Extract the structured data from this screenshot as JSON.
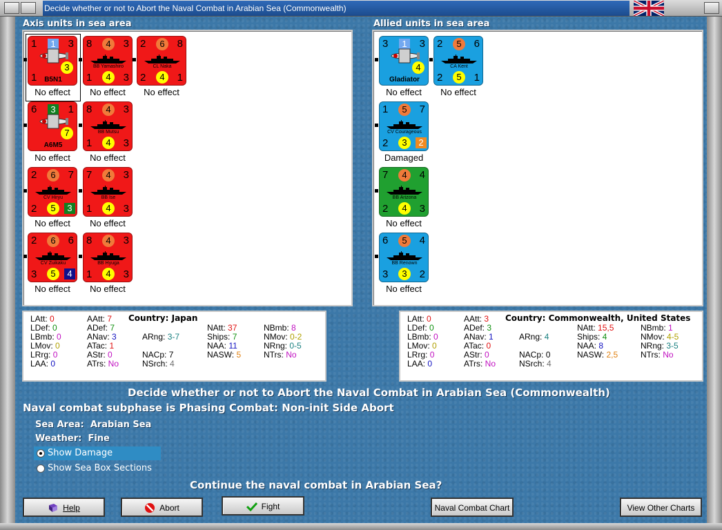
{
  "window": {
    "title": "Decide whether or not to Abort the Naval Combat in Arabian Sea (Commonwealth)"
  },
  "axis": {
    "title": "Axis units in sea area",
    "units": [
      {
        "kind": "plane",
        "name": "B5N1",
        "tl": "1",
        "blue": "1",
        "tr": "3",
        "bl": "1",
        "yellow": "3",
        "status": "No effect",
        "color": "red"
      },
      {
        "kind": "ship",
        "name": "BB Yamashiro",
        "tl": "8",
        "orange": "4",
        "tr": "3",
        "bl": "1",
        "yellow": "4",
        "br": "3",
        "status": "No effect",
        "color": "red"
      },
      {
        "kind": "ship",
        "name": "CL Naka",
        "tl": "2",
        "orange": "6",
        "tr": "8",
        "bl": "2",
        "yellow": "4",
        "br": "1",
        "status": "No effect",
        "color": "red"
      },
      {
        "kind": "plane",
        "name": "A6M5",
        "tl": "6",
        "green": "3",
        "tr": "1",
        "yellow": "7",
        "status": "No effect",
        "color": "red"
      },
      {
        "kind": "ship",
        "name": "BB Mutsu",
        "tl": "8",
        "orange": "4",
        "tr": "3",
        "bl": "1",
        "yellow": "4",
        "br": "3",
        "status": "No effect",
        "color": "red"
      },
      {
        "kind": "ship",
        "name": "CV Hiryu",
        "tl": "2",
        "orange": "6",
        "tr": "7",
        "bl": "2",
        "yellow": "5",
        "sq": "3",
        "status": "No effect",
        "color": "red"
      },
      {
        "kind": "ship",
        "name": "BB Ise",
        "tl": "7",
        "orange": "4",
        "tr": "3",
        "bl": "1",
        "yellow": "4",
        "br": "3",
        "status": "No effect",
        "color": "red"
      },
      {
        "kind": "ship",
        "name": "CV Zuikaku",
        "tl": "2",
        "orange": "6",
        "tr": "6",
        "bl": "3",
        "yellow": "5",
        "sq": "4",
        "status": "No effect",
        "color": "red"
      },
      {
        "kind": "ship",
        "name": "BB Hyuga",
        "tl": "8",
        "orange": "4",
        "tr": "3",
        "bl": "1",
        "yellow": "4",
        "br": "3",
        "status": "No effect",
        "color": "red"
      }
    ],
    "stats": {
      "country_label": "Country:",
      "country": "Japan",
      "LAtt": "0",
      "LDef": "0",
      "LBmb": "0",
      "LMov": "0",
      "LRrg": "0",
      "LAA": "0",
      "AAtt": "7",
      "ADef": "7",
      "ANav": "3",
      "ATac": "1",
      "AStr": "0",
      "ATrs": "No",
      "ARng": "3-7",
      "NACp": "7",
      "NSrch": "4",
      "NAtt": "37",
      "Ships": "7",
      "NAA": "11",
      "NASW": "5",
      "NBmb": "8",
      "NMov": "0-2",
      "NRng": "0-5",
      "NTrs": "No"
    }
  },
  "allied": {
    "title": "Allied units in sea area",
    "units": [
      {
        "kind": "plane",
        "name": "Gladiator",
        "tl": "3",
        "blue": "1",
        "tr": "3",
        "yellow": "4",
        "status": "No effect",
        "color": "blue"
      },
      {
        "kind": "ship",
        "name": "CA Kent",
        "tl": "2",
        "orange": "5",
        "tr": "6",
        "bl": "2",
        "yellow": "5",
        "br": "1",
        "status": "No effect",
        "color": "blue"
      },
      {
        "kind": "ship",
        "name": "CV Courageous",
        "tl": "1",
        "orange": "5",
        "tr": "7",
        "bl": "2",
        "yellow": "3",
        "sq": "2",
        "status": "Damaged",
        "color": "blue"
      },
      {
        "kind": "ship",
        "name": "BB Arizona",
        "tl": "7",
        "orange": "4",
        "tr": "4",
        "bl": "2",
        "yellow": "4",
        "br": "3",
        "status": "No effect",
        "color": "green"
      },
      {
        "kind": "ship",
        "name": "BB Renown",
        "tl": "6",
        "orange": "5",
        "tr": "4",
        "bl": "3",
        "yellow": "3",
        "br": "2",
        "status": "No effect",
        "color": "blue"
      }
    ],
    "stats": {
      "country_label": "Country:",
      "country": "Commonwealth, United States",
      "LAtt": "0",
      "LDef": "0",
      "LBmb": "0",
      "LMov": "0",
      "LRrg": "0",
      "LAA": "0",
      "AAtt": "3",
      "ADef": "3",
      "ANav": "1",
      "ATac": "0",
      "AStr": "0",
      "ATrs": "No",
      "ARng": "4",
      "NACp": "0",
      "NSrch": "4",
      "NAtt": "15,5",
      "Ships": "4",
      "NAA": "8",
      "NASW": "2,5",
      "NBmb": "1",
      "NMov": "4-5",
      "NRng": "3-5",
      "NTrs": "No"
    }
  },
  "main_heading": "Decide whether or not to Abort the Naval Combat in Arabian Sea (Commonwealth)",
  "subphase": "Naval combat subphase is Phasing Combat: Non-init Side Abort",
  "sea_area_label": "Sea Area:",
  "sea_area": "Arabian Sea",
  "weather_label": "Weather:",
  "weather": "Fine",
  "options": {
    "show_damage": "Show Damage",
    "show_sections": "Show Sea Box Sections"
  },
  "question": "Continue the naval combat in Arabian Sea?",
  "buttons": {
    "help": "Help",
    "abort": "Abort",
    "fight": "Fight",
    "chart": "Naval Combat Chart",
    "other": "View Other Charts"
  },
  "colors": {
    "red": "#f01818",
    "blue": "#1aa0e0",
    "green": "#20a030",
    "bg": "#3c78a8"
  }
}
